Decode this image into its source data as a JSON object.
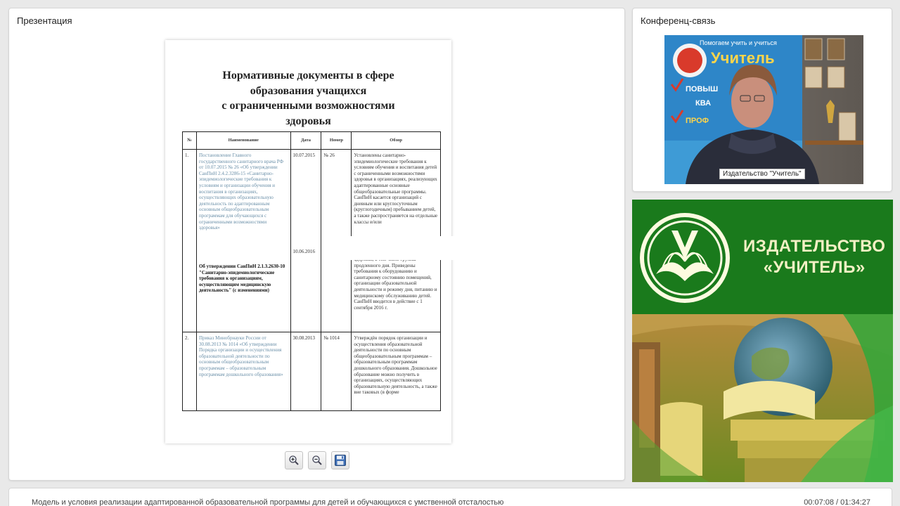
{
  "presentation": {
    "title": "Презентация",
    "slide": {
      "heading_lines": [
        "Нормативные документы в сфере",
        "образования учащихся",
        "с ограниченными возможностями",
        "здоровья"
      ],
      "table": {
        "headers": [
          "№",
          "Наименование",
          "Дата",
          "Номер",
          "Обзор"
        ],
        "rows": [
          {
            "num": "1.",
            "name": "Постановление Главного государственного санитарного врача РФ от 10.07.2015 № 26 «Об утверждении СанПиН 2.4.2.3286-15 «Санитарно-эпидемиологические требования к условиям и организации обучения и воспитания в организациях, осуществляющих образовательную деятельность по адаптированным основным общеобразовательным программам для обучающихся с ограниченными возможностями здоровья»",
            "name2": "Об утверждении СанПиН 2.1.3.2630-10 \"Санитарно-эпидемиологические требования к организациям, осуществляющим медицинскую деятельность\" (с изменениями)",
            "date": "10.07.2015",
            "date2": "10.06.2016",
            "number": "№ 26",
            "review": "Установлены санитарно-эпидемиологические требования к условиям обучения и воспитания детей с ограниченными возможностями здоровья в организациях, реализующих адаптированные основные общеобразовательные программы. СанПиН касается организаций с дневным или круглосуточным (круглогодичным) пребыванием детей, а также распространяется на отдельные классы и/или",
            "review2": "здоровья, в том числе группы продленного дня. Приведены требования к оборудованию и санитарному состоянию помещений, организации образовательной деятельности и режиму дня, питанию и медицинскому обслуживанию детей. СанПиН вводится в действие с 1 сентября 2016 г."
          },
          {
            "num": "2.",
            "name": "Приказ Минобрнауки России от 30.08.2013 № 1014 «Об утверждении Порядка организации и осуществления образовательной деятельности по основным общеобразовательным программам – образовательным программам дошкольного образования»",
            "date": "30.08.2013",
            "number": "№ 1014",
            "review": "Утверждён порядок организации и осуществления образовательной деятельности по основным общеобразовательным программам – образовательным программам дошкольного образования. Дошкольное образование можно получить в организациях, осуществляющих образовательную деятельность, а также вне таковых (в форме"
          }
        ]
      }
    },
    "toolbar": {
      "zoom_in_icon": "zoom-in-icon",
      "zoom_out_icon": "zoom-out-icon",
      "save_icon": "floppy-disk-icon"
    }
  },
  "conference": {
    "title": "Конференц-связь",
    "video_caption": "Издательство \"Учитель\"",
    "poster_lines": [
      "Помогаем учить и учиться",
      "Учитель",
      "ПОВЫШ",
      "КВА",
      "ПРОФ"
    ]
  },
  "banner": {
    "text_lines": [
      "ИЗДАТЕЛЬСТВО",
      "«УЧИТЕЛЬ»"
    ],
    "colors": {
      "green": "#1a7a1c",
      "text": "#f3f0c4"
    }
  },
  "footer": {
    "lecture_title": "Модель и условия реализации адаптированной образовательной программы для детей и обучающихся с умственной отсталостью",
    "timer": "00:07:08 / 01:34:27"
  }
}
